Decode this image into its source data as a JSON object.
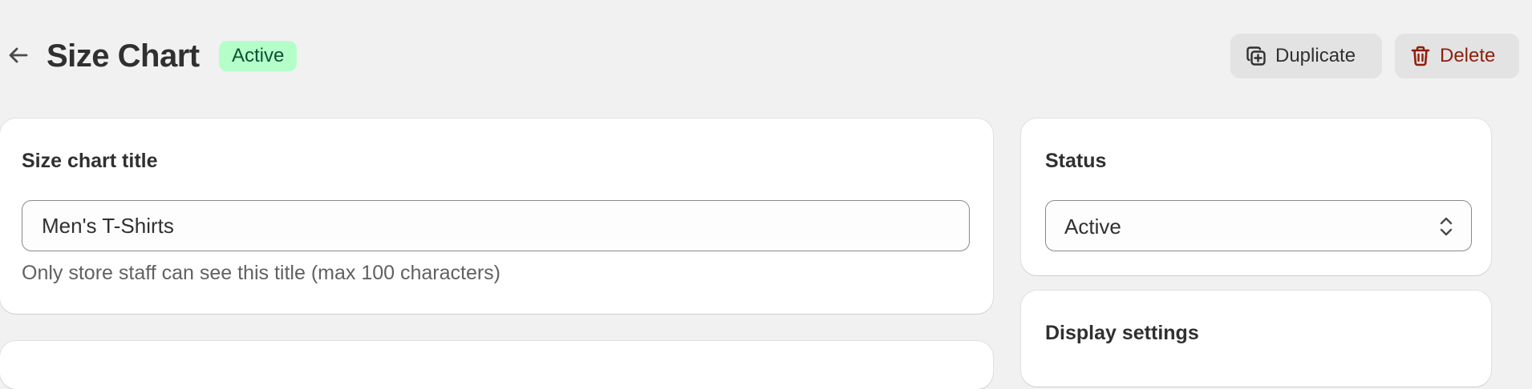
{
  "header": {
    "title": "Size Chart",
    "status_badge": "Active",
    "duplicate_label": "Duplicate",
    "delete_label": "Delete"
  },
  "title_card": {
    "heading": "Size chart title",
    "input_value": "Men's T-Shirts",
    "help_text": "Only store staff can see this title (max 100 characters)"
  },
  "status_card": {
    "heading": "Status",
    "selected": "Active"
  },
  "display_card": {
    "heading": "Display settings"
  },
  "icons": {
    "back": "arrow-left-icon",
    "duplicate": "duplicate-icon",
    "delete": "trash-icon",
    "select": "chevron-up-down-icon"
  },
  "colors": {
    "badge_bg": "#b4fec9",
    "badge_text": "#0c5132",
    "delete_text": "#8e1f0b",
    "page_bg": "#f1f1f1"
  }
}
